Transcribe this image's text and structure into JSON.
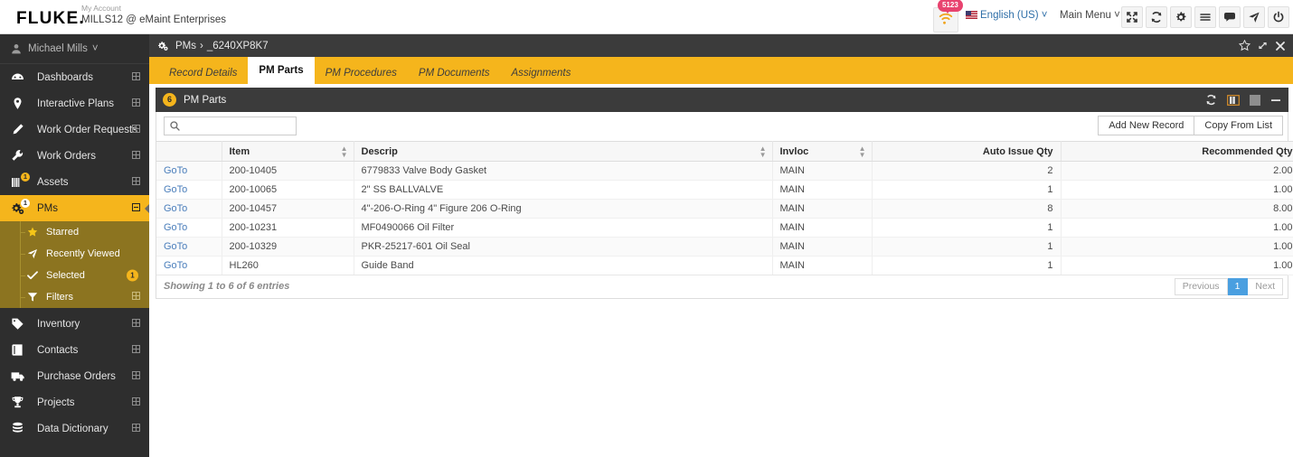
{
  "header": {
    "logo": "FLUKE",
    "logo_dot": ".",
    "account_label": "My Account",
    "account_name": "MILLS12 @ eMaint Enterprises",
    "notification_count": "5123",
    "notification_icon": "wifi-signal-icon",
    "language": "English (US)",
    "language_caret": "˅",
    "main_menu": "Main Menu",
    "main_menu_caret": "˅",
    "icons": [
      {
        "name": "expand-icon"
      },
      {
        "name": "refresh-icon"
      },
      {
        "name": "gear-icon"
      },
      {
        "name": "menu-icon"
      },
      {
        "name": "chat-icon"
      },
      {
        "name": "send-icon"
      },
      {
        "name": "power-icon"
      }
    ]
  },
  "sidebar": {
    "user": "Michael Mills",
    "user_caret": "˅",
    "items": [
      {
        "label": "Dashboards",
        "icon": "dashboard-icon",
        "badge": "",
        "expand": true
      },
      {
        "label": "Interactive Plans",
        "icon": "map-pin-icon",
        "badge": "",
        "expand": true
      },
      {
        "label": "Work Order Requests",
        "icon": "pencil-icon",
        "badge": "",
        "expand": true
      },
      {
        "label": "Work Orders",
        "icon": "wrench-icon",
        "badge": "",
        "expand": true
      },
      {
        "label": "Assets",
        "icon": "assets-icon",
        "badge": "1",
        "expand": true
      },
      {
        "label": "PMs",
        "icon": "gears-icon",
        "badge": "1",
        "expand": true,
        "active": true
      }
    ],
    "subitems": [
      {
        "label": "Starred",
        "icon": "star-icon",
        "badge": ""
      },
      {
        "label": "Recently Viewed",
        "icon": "send-icon",
        "badge": ""
      },
      {
        "label": "Selected",
        "icon": "check-icon",
        "badge": "1"
      },
      {
        "label": "Filters",
        "icon": "filter-icon",
        "badge": "",
        "expand": true
      }
    ],
    "items_bottom": [
      {
        "label": "Inventory",
        "icon": "tag-icon",
        "expand": true
      },
      {
        "label": "Contacts",
        "icon": "book-icon",
        "expand": true
      },
      {
        "label": "Purchase Orders",
        "icon": "truck-icon",
        "expand": true
      },
      {
        "label": "Projects",
        "icon": "trophy-icon",
        "expand": true
      },
      {
        "label": "Data Dictionary",
        "icon": "database-icon",
        "expand": true
      }
    ]
  },
  "breadcrumb": {
    "icon": "gears-icon",
    "parent": "PMs",
    "separator": "›",
    "current": "_6240XP8K7",
    "controls": [
      {
        "name": "star-icon"
      },
      {
        "name": "expand-icon"
      },
      {
        "name": "close-icon"
      }
    ]
  },
  "tabs": [
    {
      "label": "Record Details",
      "active": false
    },
    {
      "label": "PM Parts",
      "active": true
    },
    {
      "label": "PM Procedures",
      "active": false
    },
    {
      "label": "PM Documents",
      "active": false
    },
    {
      "label": "Assignments",
      "active": false
    }
  ],
  "panel": {
    "count": "6",
    "title": "PM Parts",
    "tools": [
      {
        "name": "refresh-icon"
      },
      {
        "name": "columns-icon"
      },
      {
        "name": "maximize-icon"
      },
      {
        "name": "minimize-icon"
      }
    ]
  },
  "toolbar": {
    "search_value": "",
    "search_placeholder": "",
    "search_icon": "search-icon",
    "add_new_record": "Add New Record",
    "copy_from_list": "Copy From List"
  },
  "table": {
    "columns": [
      {
        "label": "",
        "align": "left",
        "sortable": false
      },
      {
        "label": "Item",
        "align": "left",
        "sortable": true
      },
      {
        "label": "Descrip",
        "align": "left",
        "sortable": true
      },
      {
        "label": "Invloc",
        "align": "left",
        "sortable": true
      },
      {
        "label": "Auto Issue Qty",
        "align": "right",
        "sortable": false
      },
      {
        "label": "Recommended Qty",
        "align": "right",
        "sortable": false
      }
    ],
    "goto_label": "GoTo",
    "rows": [
      {
        "item": "200-10405",
        "descrip": "6779833 Valve Body Gasket",
        "invloc": "MAIN",
        "auto_issue_qty": "2",
        "recommended_qty": "2.00"
      },
      {
        "item": "200-10065",
        "descrip": "2\" SS BALLVALVE",
        "invloc": "MAIN",
        "auto_issue_qty": "1",
        "recommended_qty": "1.00"
      },
      {
        "item": "200-10457",
        "descrip": "4\"-206-O-Ring 4\" Figure 206 O-Ring",
        "invloc": "MAIN",
        "auto_issue_qty": "8",
        "recommended_qty": "8.00"
      },
      {
        "item": "200-10231",
        "descrip": "MF0490066 Oil Filter",
        "invloc": "MAIN",
        "auto_issue_qty": "1",
        "recommended_qty": "1.00"
      },
      {
        "item": "200-10329",
        "descrip": "PKR-25217-601 Oil Seal",
        "invloc": "MAIN",
        "auto_issue_qty": "1",
        "recommended_qty": "1.00"
      },
      {
        "item": "HL260",
        "descrip": "Guide Band",
        "invloc": "MAIN",
        "auto_issue_qty": "1",
        "recommended_qty": "1.00"
      }
    ]
  },
  "footer": {
    "showing": "Showing 1 to 6 of 6 entries",
    "previous": "Previous",
    "page": "1",
    "next": "Next"
  },
  "colors": {
    "accent": "#f5b51c",
    "sidebar": "#2e2e2e",
    "sub_sidebar": "#8c7420",
    "link": "#4a7ebb",
    "pager_active": "#4a9fe0",
    "badge_red": "#e8436f"
  }
}
